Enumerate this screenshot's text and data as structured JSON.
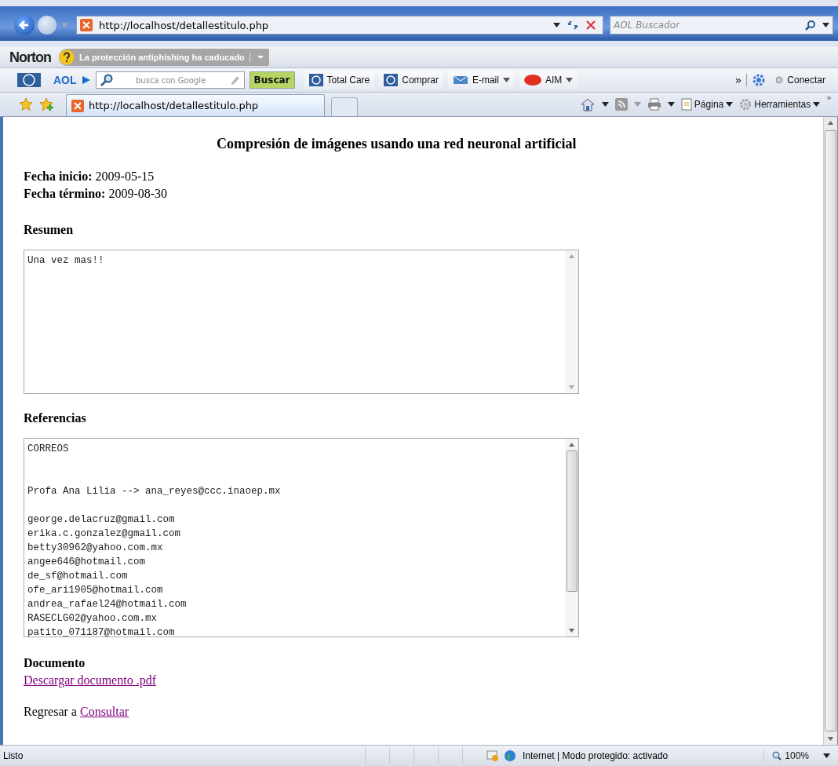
{
  "address_bar": {
    "url": "http://localhost/detallestitulo.php"
  },
  "search_box": {
    "placeholder": "AOL Buscador"
  },
  "norton_bar": {
    "brand": "Norton",
    "warning": "La protección antiphishing ha caducado"
  },
  "aol_toolbar": {
    "brand": "AOL",
    "search_placeholder": "busca con Google",
    "search_button": "Buscar",
    "buttons": [
      {
        "label": "Total Care",
        "kind": "hp",
        "dropdown": false
      },
      {
        "label": "Comprar",
        "kind": "hp",
        "dropdown": false
      },
      {
        "label": "E-mail",
        "kind": "mail",
        "dropdown": true
      },
      {
        "label": "AIM",
        "kind": "aim",
        "dropdown": true
      }
    ],
    "more": "»",
    "connect": "Conectar"
  },
  "tab": {
    "title": "http://localhost/detallestitulo.php"
  },
  "command_bar": {
    "page_menu": "Página",
    "tools_menu": "Herramientas",
    "more": "»"
  },
  "page": {
    "title": "Compresión de imágenes usando una red neuronal artificial",
    "dates": [
      {
        "label": "Fecha inicio:",
        "value": "2009-05-15"
      },
      {
        "label": "Fecha término:",
        "value": "2009-08-30"
      }
    ],
    "summary": {
      "heading": "Resumen",
      "lines": [
        "Una vez mas!!"
      ]
    },
    "references": {
      "heading": "Referencias",
      "lines": [
        {
          "kind": "text",
          "text": "CORREOS"
        },
        {
          "kind": "blank"
        },
        {
          "kind": "blank"
        },
        {
          "kind": "text",
          "text": "Profa Ana Lilia --> ana_reyes@ccc.inaoep.mx"
        },
        {
          "kind": "blank"
        },
        {
          "kind": "text",
          "text": "george.delacruz@gmail.com"
        },
        {
          "kind": "text",
          "text": "erika.c.gonzalez@gmail.com"
        },
        {
          "kind": "text",
          "text": "betty30962@yahoo.com.mx"
        },
        {
          "kind": "text",
          "text": "angee646@hotmail.com"
        },
        {
          "kind": "text",
          "text": "de_sf@hotmail.com"
        },
        {
          "kind": "text",
          "text": "ofe_ari1905@hotmail.com"
        },
        {
          "kind": "text",
          "text": "andrea_rafael24@hotmail.com"
        },
        {
          "kind": "text",
          "text": "RASECLG02@yahoo.com.mx"
        },
        {
          "kind": "text",
          "text": "patito_071187@hotmail.com"
        }
      ]
    },
    "document": {
      "heading": "Documento",
      "link": "Descargar documento .pdf"
    },
    "back": {
      "text": "Regresar a",
      "link": "Consultar"
    }
  },
  "status_bar": {
    "status": "Listo",
    "zone": "Internet | Modo protegido: activado",
    "zoom": "100%"
  }
}
